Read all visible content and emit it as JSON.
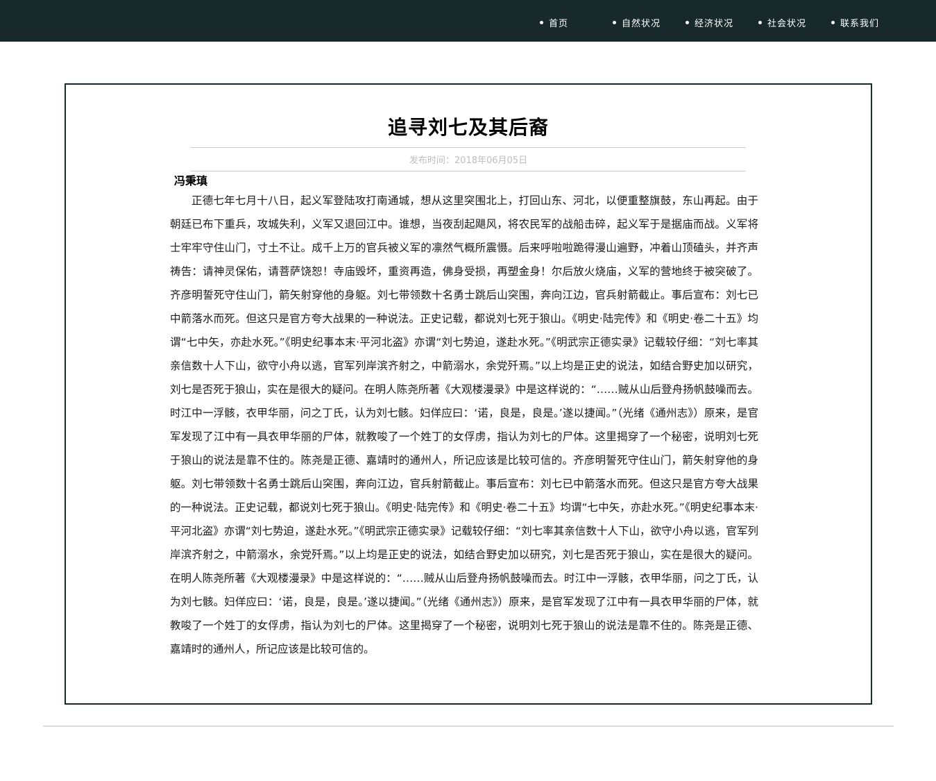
{
  "nav": {
    "items": [
      {
        "label": "首页"
      },
      {
        "label": "自然状况"
      },
      {
        "label": "经济状况"
      },
      {
        "label": "社会状况"
      },
      {
        "label": "联系我们"
      }
    ]
  },
  "article": {
    "title": "追寻刘七及其后裔",
    "publish_time": "发布时间：2018年06月05日",
    "author": "冯秉瑱",
    "body": "正德七年七月十八日，起义军登陆攻打南通城，想从这里突围北上，打回山东、河北，以便重整旗鼓，东山再起。由于朝廷已布下重兵，攻城失利，义军又退回江中。谁想，当夜刮起飓风，将农民军的战船击碎，起义军于是据庙而战。义军将士牢牢守住山门，寸土不让。成千上万的官兵被义军的凛然气概所震慑。后来呼啦啦跪得漫山遍野，冲着山顶磕头，并齐声祷告：请神灵保佑，请菩萨饶恕！寺庙毁坏，重资再造，佛身受损，再塑金身！尔后放火烧庙，义军的营地终于被突破了。齐彦明誓死守住山门，箭矢射穿他的身躯。刘七带领数十名勇士跳后山突围，奔向江边，官兵射箭截止。事后宣布：刘七已中箭落水而死。但这只是官方夸大战果的一种说法。正史记载，都说刘七死于狼山。《明史·陆完传》和《明史·卷二十五》均谓“七中矢，亦赴水死。”《明史纪事本末·平河北盗》亦谓“刘七势迫，遂赴水死。”《明武宗正德实录》记载较仔细：“刘七率其亲信数十人下山，欲守小舟以逃，官军列岸滨齐射之，中箭溺水，余党歼焉。”以上均是正史的说法，如结合野史加以研究，刘七是否死于狼山，实在是很大的疑问。在明人陈尧所著《大观楼漫录》中是这样说的：“……贼从山后登舟扬帆鼓噪而去。时江中一浮骸，衣甲华丽，问之丁氏，认为刘七骸。妇佯应曰：‘诺，良是，良是。’遂以捷闻。”（光绪《通州志》）原来，是官军发现了江中有一具衣甲华丽的尸体，就教唆了一个姓丁的女俘虏，指认为刘七的尸体。这里揭穿了一个秘密，说明刘七死于狼山的说法是靠不住的。陈尧是正德、嘉靖时的通州人，所记应该是比较可信的。齐彦明誓死守住山门，箭矢射穿他的身躯。刘七带领数十名勇士跳后山突围，奔向江边，官兵射箭截止。事后宣布：刘七已中箭落水而死。但这只是官方夸大战果的一种说法。正史记载，都说刘七死于狼山。《明史·陆完传》和《明史·卷二十五》均谓“七中矢，亦赴水死。”《明史纪事本末·平河北盗》亦谓“刘七势迫，遂赴水死。”《明武宗正德实录》记载较仔细：“刘七率其亲信数十人下山，欲守小舟以逃，官军列岸滨齐射之，中箭溺水，余党歼焉。”以上均是正史的说法，如结合野史加以研究，刘七是否死于狼山，实在是很大的疑问。在明人陈尧所著《大观楼漫录》中是这样说的：“……贼从山后登舟扬帆鼓噪而去。时江中一浮骸，衣甲华丽，问之丁氏，认为刘七骸。妇佯应曰：‘诺，良是，良是。’遂以捷闻。”（光绪《通州志》）原来，是官军发现了江中有一具衣甲华丽的尸体，就教唆了一个姓丁的女俘虏，指认为刘七的尸体。这里揭穿了一个秘密，说明刘七死于狼山的说法是靠不住的。陈尧是正德、嘉靖时的通州人，所记应该是比较可信的。"
  },
  "colors": {
    "topbar": "#17292a",
    "border": "#17292a",
    "publish_time": "#bdbdbd"
  }
}
